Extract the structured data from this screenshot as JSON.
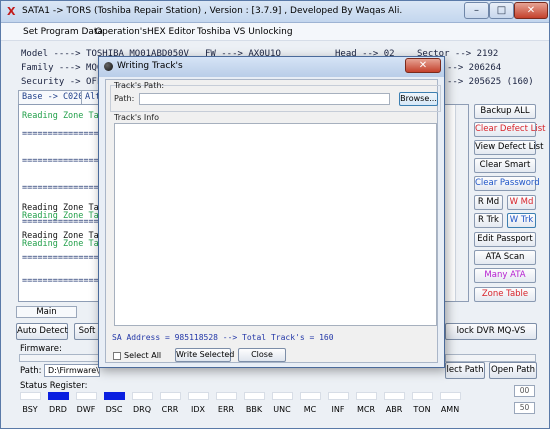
{
  "app": {
    "title": "SATA1 -> TORS (Toshiba Repair Station) , Version : [3.7.9] , Developed By Waqas Ali.",
    "icon_letter": "X"
  },
  "window_controls": {
    "minimize": "–",
    "maximize": "□",
    "close": "✕"
  },
  "menu": [
    "Set Program Data",
    "Operation's",
    "HEX Editor",
    "Toshiba VS Unlocking"
  ],
  "info": {
    "model": "Model ----> TOSHIBA MQ01ABD050V",
    "family": "Family ---> MQ01A",
    "security": "Security -> OFF",
    "fw": "FW ---> AX0U1Q",
    "head": "Head --> 02",
    "sector": "Sector --> 2192",
    "sector2": "--> 206264",
    "sector3": "--> 205625 (160)"
  },
  "tabs": [
    "Base -> C020",
    "Alt"
  ],
  "log": [
    {
      "text": "Reading Zone Tabl",
      "style": "green"
    },
    {
      "text": "==================",
      "style": "eq"
    },
    {
      "text": "==================",
      "style": "eq"
    },
    {
      "text": "==================",
      "style": "eq"
    },
    {
      "text": "Reading Zone Tabl",
      "style": "black"
    },
    {
      "text": "Reading Zone Tabl",
      "style": "green"
    },
    {
      "text": "==================",
      "style": "eq"
    },
    {
      "text": "Reading Zone Tabl",
      "style": "black"
    },
    {
      "text": "Reading Zone Tabl",
      "style": "green"
    },
    {
      "text": "==================",
      "style": "eq"
    },
    {
      "text": "==================",
      "style": "eq"
    }
  ],
  "right_buttons": {
    "backup_all": "Backup ALL",
    "clear_defect_list": "Clear Defect List",
    "view_defect_list": "View Defect List",
    "clear_smart": "Clear Smart",
    "clear_password": "Clear Password",
    "r_md": "R Md",
    "w_md": "W Md",
    "r_trk": "R Trk",
    "w_trk": "W Trk",
    "edit_passport": "Edit Passport",
    "ata_scan": "ATA Scan",
    "many_ata": "Many ATA",
    "zone_table": "Zone Table"
  },
  "bottom": {
    "main_tab": "Main",
    "auto_detect": "Auto Detect",
    "soft_partial": "Soft",
    "unlock_dvr": "lock DVR MQ-VS",
    "firmware_label": "Firmware:",
    "path_label": "Path:",
    "path_value": "D:\\Firmware\\Toshiba",
    "select_path": "lect Path",
    "open_path": "Open Path",
    "status_register_label": "Status Register:",
    "box_top": "00",
    "box_bottom": "50"
  },
  "status_register": [
    {
      "name": "BSY",
      "on": false
    },
    {
      "name": "DRD",
      "on": true
    },
    {
      "name": "DWF",
      "on": false
    },
    {
      "name": "DSC",
      "on": true
    },
    {
      "name": "DRQ",
      "on": false
    },
    {
      "name": "CRR",
      "on": false
    },
    {
      "name": "IDX",
      "on": false
    },
    {
      "name": "ERR",
      "on": false
    },
    {
      "name": "BBK",
      "on": false
    },
    {
      "name": "UNC",
      "on": false
    },
    {
      "name": "MC",
      "on": false
    },
    {
      "name": "INF",
      "on": false
    },
    {
      "name": "MCR",
      "on": false
    },
    {
      "name": "ABR",
      "on": false
    },
    {
      "name": "TON",
      "on": false
    },
    {
      "name": "AMN",
      "on": false
    }
  ],
  "dialog": {
    "title": "Writing Track's",
    "close": "✕",
    "tracks_path_group": "Track's Path:",
    "path_label": "Path:",
    "path_value": "",
    "browse": "Browse...",
    "tracks_info_group": "Track's Info",
    "sa_text": "SA Address = 985118528 --> Total Track's = 160",
    "select_all": "Select All",
    "write_selected": "Write Selected",
    "close_button": "Close"
  },
  "colors": {
    "led_on": "#0a1fe0",
    "log_green": "#22a04a",
    "red_text": "#d8232a",
    "blue_text": "#1f55c8",
    "magenta_text": "#b61fd0"
  }
}
